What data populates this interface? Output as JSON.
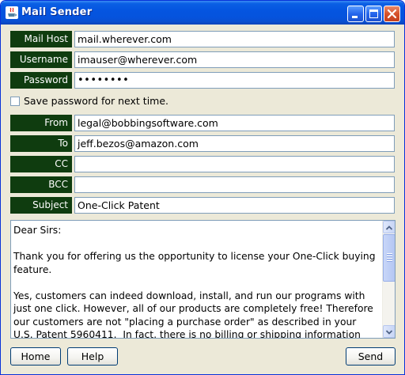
{
  "window": {
    "title": "Mail Sender",
    "icon": "java-cup-icon",
    "controls": [
      "minimize-icon",
      "maximize-icon",
      "close-icon"
    ]
  },
  "form": {
    "mail_host": {
      "label": "Mail Host",
      "value": "mail.wherever.com"
    },
    "username": {
      "label": "Username",
      "value": "imauser@wherever.com"
    },
    "password": {
      "label": "Password",
      "value": "••••••••"
    },
    "save_password_label": "Save password for next time.",
    "save_password_checked": false,
    "from": {
      "label": "From",
      "value": "legal@bobbingsoftware.com"
    },
    "to": {
      "label": "To",
      "value": "jeff.bezos@amazon.com"
    },
    "cc": {
      "label": "CC",
      "value": ""
    },
    "bcc": {
      "label": "BCC",
      "value": ""
    },
    "subject": {
      "label": "Subject",
      "value": "One-Click Patent"
    }
  },
  "message": {
    "body": "Dear Sirs:\n\nThank you for offering us the opportunity to license your One-Click buying\nfeature.\n\nYes, customers can indeed download, install, and run our programs with\njust one click. However, all of our products are completely free! Therefore\nour customers are not \"placing a purchase order\" as described in your\nU.S. Patent 5960411.  In fact, there is no billing or shipping information"
  },
  "buttons": {
    "home": "Home",
    "help": "Help",
    "send": "Send"
  },
  "colors": {
    "label_background": "#0f3c0f",
    "label_text": "#ffffff",
    "window_background": "#ece9d8",
    "titlebar": "#0555e0"
  }
}
